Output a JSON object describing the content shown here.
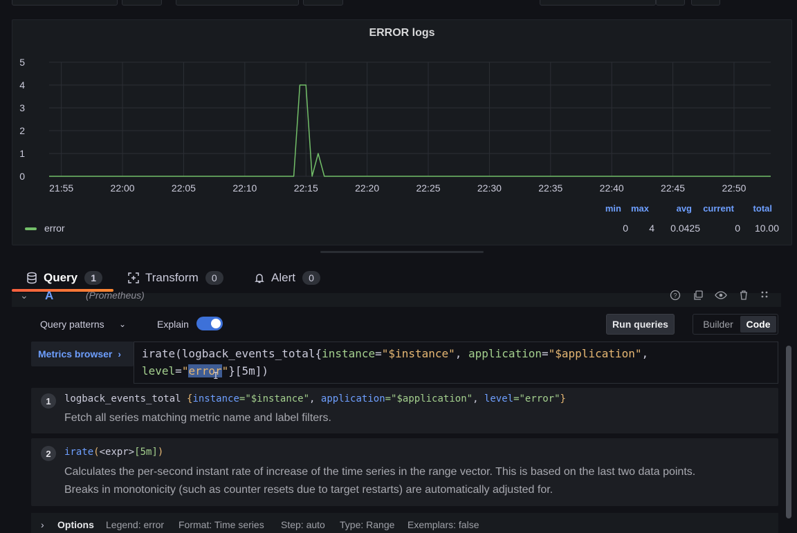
{
  "panel": {
    "title": "ERROR logs",
    "legend": {
      "name": "error",
      "color": "#73bf69"
    },
    "stats": {
      "headers": [
        "min",
        "max",
        "avg",
        "current",
        "total"
      ],
      "values": [
        "0",
        "4",
        "0.0425",
        "0",
        "10.00"
      ]
    }
  },
  "chart_data": {
    "type": "line",
    "title": "ERROR logs",
    "xlabel": "",
    "ylabel": "",
    "x_ticks": [
      "21:55",
      "22:00",
      "22:05",
      "22:10",
      "22:15",
      "22:20",
      "22:25",
      "22:30",
      "22:35",
      "22:40",
      "22:45",
      "22:50"
    ],
    "y_ticks": [
      "0",
      "1",
      "2",
      "3",
      "4",
      "5"
    ],
    "ylim": [
      0,
      5
    ],
    "grid": true,
    "legend_placement": "bottom-left",
    "series": [
      {
        "name": "error",
        "color": "#73bf69",
        "x": [
          "21:54",
          "22:14",
          "22:14:30",
          "22:15",
          "22:15:30",
          "22:16",
          "22:16:30",
          "22:17",
          "22:53"
        ],
        "values": [
          0,
          0,
          4,
          4,
          0,
          1,
          0,
          0,
          0
        ]
      }
    ]
  },
  "tabs": [
    {
      "label": "Query",
      "count": "1",
      "icon": "database-icon"
    },
    {
      "label": "Transform",
      "count": "0",
      "icon": "transform-icon"
    },
    {
      "label": "Alert",
      "count": "0",
      "icon": "bell-icon"
    }
  ],
  "query": {
    "name": "A",
    "datasource": "(Prometheus)",
    "query_patterns_label": "Query patterns",
    "explain_label": "Explain",
    "explain_on": true,
    "run_label": "Run queries",
    "mode_builder": "Builder",
    "mode_code": "Code",
    "metrics_browser": "Metrics browser",
    "code_line1": {
      "fn": "irate(logback_events_total{",
      "k1": "instance",
      "eq1": "=",
      "v1": "\"$instance\"",
      "sep1": ", ",
      "k2": "application",
      "eq2": "=",
      "v2": "\"$application\"",
      "sep2": ","
    },
    "code_line2": {
      "k3": "level",
      "eq3": "=",
      "q_open": "\"",
      "v3_sel": "error",
      "q_close": "\"",
      "tail": "}[5m])"
    }
  },
  "explain_steps": [
    {
      "num": "1",
      "metric": "logback_events_total ",
      "brace_open": "{",
      "l1": "instance",
      "v1": "=\"$instance\"",
      "c1": ", ",
      "l2": "application",
      "v2": "=\"$application\"",
      "c2": ", ",
      "l3": "level",
      "v3": "=\"error\"",
      "brace_close": "}",
      "desc": "Fetch all series matching metric name and label filters."
    },
    {
      "num": "2",
      "fn": "irate",
      "open": "(",
      "arg": "<expr>",
      "range": "[5m]",
      "close": ")",
      "desc1": "Calculates the per-second instant rate of increase of the time series in the range vector. This is based on the last two data points.",
      "desc2": "Breaks in monotonicity (such as counter resets due to target restarts) are automatically adjusted for."
    }
  ],
  "options": {
    "title": "Options",
    "items": [
      "Legend: error",
      "Format: Time series",
      "Step: auto",
      "Type: Range",
      "Exemplars: false"
    ]
  }
}
